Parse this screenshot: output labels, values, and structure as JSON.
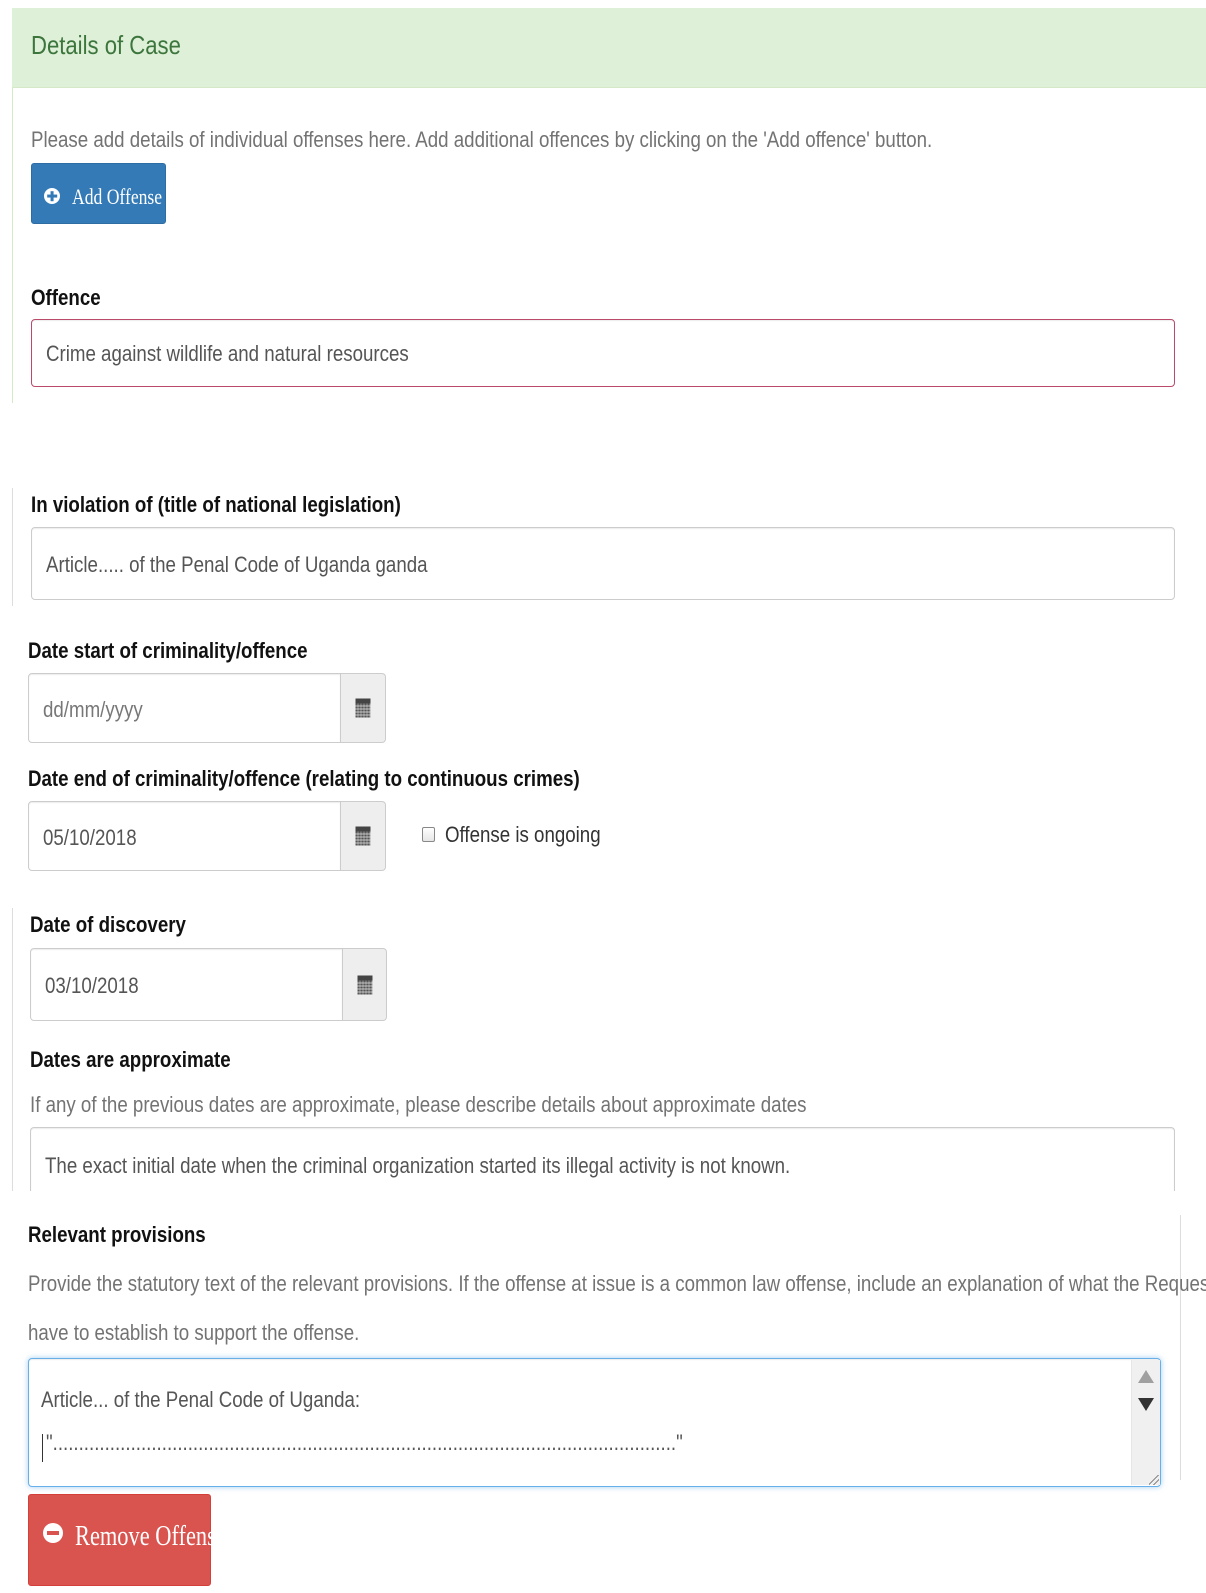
{
  "panel": {
    "title": "Details of Case"
  },
  "intro": {
    "help_text": "Please add details of individual offenses here. Add additional offences by clicking on the 'Add offence' button.",
    "add_button_label": "Add  Offense"
  },
  "offence": {
    "label": "Offence",
    "value": "Crime against wildlife and natural resources"
  },
  "violation": {
    "label": "In violation of (title of national legislation)",
    "value": "Article..... of the Penal Code of Uganda ganda"
  },
  "date_start": {
    "label": "Date start of criminality/offence",
    "placeholder": "dd/mm/yyyy",
    "value": ""
  },
  "date_end": {
    "label": "Date end of criminality/offence (relating to continuous crimes)",
    "value": "05/10/2018",
    "ongoing_label": "Offense is ongoing",
    "ongoing_checked": false
  },
  "date_discovery": {
    "label": "Date of discovery",
    "value": "03/10/2018"
  },
  "approximate": {
    "label": "Dates are approximate",
    "help_text": "If any of the previous dates are approximate, please describe details about approximate dates",
    "value": "The exact initial date when the criminal organization started its illegal activity is not known."
  },
  "provisions": {
    "label": "Relevant provisions",
    "help_line1": "Provide the statutory text of the relevant provisions. If the offense at issue is a common law offense, include an explanation of what the Requested country will",
    "help_line2": "have to establish to support the offense.",
    "value_line1": "Article... of the Penal Code of Uganda:",
    "value_line2": "\"........................................................................................................................\""
  },
  "remove_button_label": "Remove  Offense",
  "icons": {
    "add": "plus-circle-icon",
    "remove": "minus-circle-icon",
    "calendar": "calendar-icon"
  },
  "colors": {
    "panel_heading_bg": "#dff0d8",
    "panel_title": "#3c763d",
    "primary": "#337ab7",
    "danger": "#d9534f",
    "invalid_border": "#b94a6c",
    "focus_border": "#66afe9"
  }
}
